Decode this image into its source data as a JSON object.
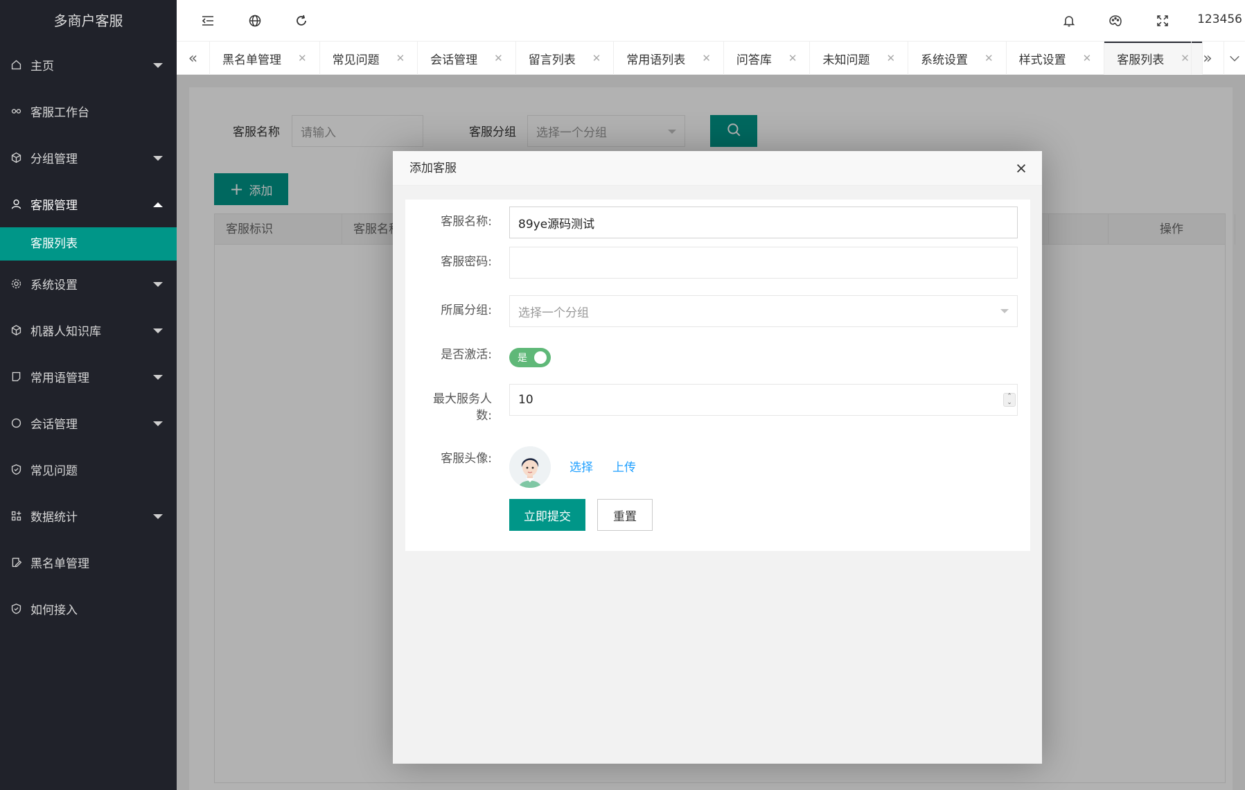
{
  "app": {
    "title": "多商户客服",
    "user": "123456"
  },
  "sidebar": {
    "items": [
      {
        "label": "主页",
        "icon": "home-icon",
        "expandable": true
      },
      {
        "label": "客服工作台",
        "icon": "link-icon",
        "expandable": false
      },
      {
        "label": "分组管理",
        "icon": "cube-icon",
        "expandable": true
      },
      {
        "label": "客服管理",
        "icon": "user-icon",
        "expandable": true,
        "expanded": true
      },
      {
        "label": "系统设置",
        "icon": "gear-icon",
        "expandable": true
      },
      {
        "label": "机器人知识库",
        "icon": "cube-icon",
        "expandable": true
      },
      {
        "label": "常用语管理",
        "icon": "note-icon",
        "expandable": true
      },
      {
        "label": "会话管理",
        "icon": "chat-icon",
        "expandable": true
      },
      {
        "label": "常见问题",
        "icon": "shield-icon",
        "expandable": false
      },
      {
        "label": "数据统计",
        "icon": "apps-icon",
        "expandable": true
      },
      {
        "label": "黑名单管理",
        "icon": "edit-icon",
        "expandable": false
      },
      {
        "label": "如何接入",
        "icon": "shield-icon",
        "expandable": false
      }
    ],
    "sub_active": "客服列表"
  },
  "tabs": [
    {
      "label": "黑名单管理"
    },
    {
      "label": "常见问题"
    },
    {
      "label": "会话管理"
    },
    {
      "label": "留言列表"
    },
    {
      "label": "常用语列表"
    },
    {
      "label": "问答库"
    },
    {
      "label": "未知问题"
    },
    {
      "label": "系统设置"
    },
    {
      "label": "样式设置"
    },
    {
      "label": "客服列表",
      "active": true
    }
  ],
  "search": {
    "name_label": "客服名称",
    "name_placeholder": "请输入",
    "group_label": "客服分组",
    "group_placeholder": "选择一个分组"
  },
  "toolbar": {
    "add_label": "添加"
  },
  "table": {
    "headers": [
      "客服标识",
      "客服名称",
      "操作"
    ]
  },
  "modal": {
    "title": "添加客服",
    "fields": {
      "name_label": "客服名称:",
      "name_value": "89ye源码测试",
      "password_label": "客服密码:",
      "password_value": "",
      "group_label": "所属分组:",
      "group_placeholder": "选择一个分组",
      "active_label": "是否激活:",
      "active_text": "是",
      "max_label_1": "最大服务人",
      "max_label_2": "数:",
      "max_value": "10",
      "avatar_label": "客服头像:"
    },
    "links": {
      "choose": "选择",
      "upload": "上传"
    },
    "buttons": {
      "submit": "立即提交",
      "reset": "重置"
    }
  },
  "colors": {
    "sidebar_bg": "#20222a",
    "accent": "#009688",
    "switch_on": "#5fb878",
    "link": "#1e9fff"
  }
}
